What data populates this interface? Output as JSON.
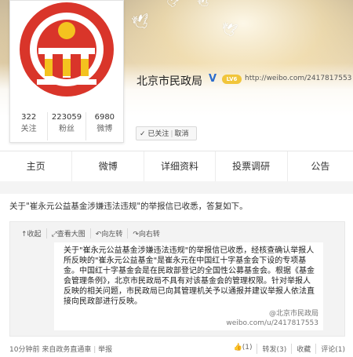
{
  "profile": {
    "name": "北京市民政局",
    "level_badge": "LV6",
    "url": "http://weibo.com/2417817553",
    "follow_status": "已关注",
    "cancel_label": "取消"
  },
  "stats": [
    {
      "num": "322",
      "label": "关注"
    },
    {
      "num": "223059",
      "label": "粉丝"
    },
    {
      "num": "6980",
      "label": "微博"
    }
  ],
  "tabs": [
    "主页",
    "微博",
    "详细资料",
    "投票调研",
    "公告"
  ],
  "post": {
    "text": "关于\"崔永元公益基金涉嫌违法违规\"的举报信已收悉，答复如下。"
  },
  "quote_toolbar": [
    "收起",
    "查看大图",
    "向左转",
    "向右转"
  ],
  "quote_body": "关于\"崔永元公益基金涉嫌违法违规\"的举报信已收悉，经核查确认举报人所反映的\"崔永元公益基金\"是崔永元在中国红十字基金会下设的专项基金。中国红十字基金会是在民政部登记的全国性公募基金会。根据《基金会管理条例》，北京市民政局不具有对该基金会的管理权限。针对举报人反映的相关问题，市民政局已向其管理机关予以通报并建议举报人依法直接向民政部进行反映。",
  "watermark": {
    "line1": "@北京市民政局",
    "line2": "weibo.com/u/2417817553"
  },
  "footer": {
    "time": "10分钟前",
    "source": "来自政务直通車",
    "report": "举报",
    "like": "(1)",
    "repost": "转发(3)",
    "favorite": "收藏",
    "comment": "评论(1)"
  },
  "colors": {
    "brand_red": "#d9352a",
    "link_blue": "#2a6bcc",
    "badge_gold": "#f1c53a"
  }
}
